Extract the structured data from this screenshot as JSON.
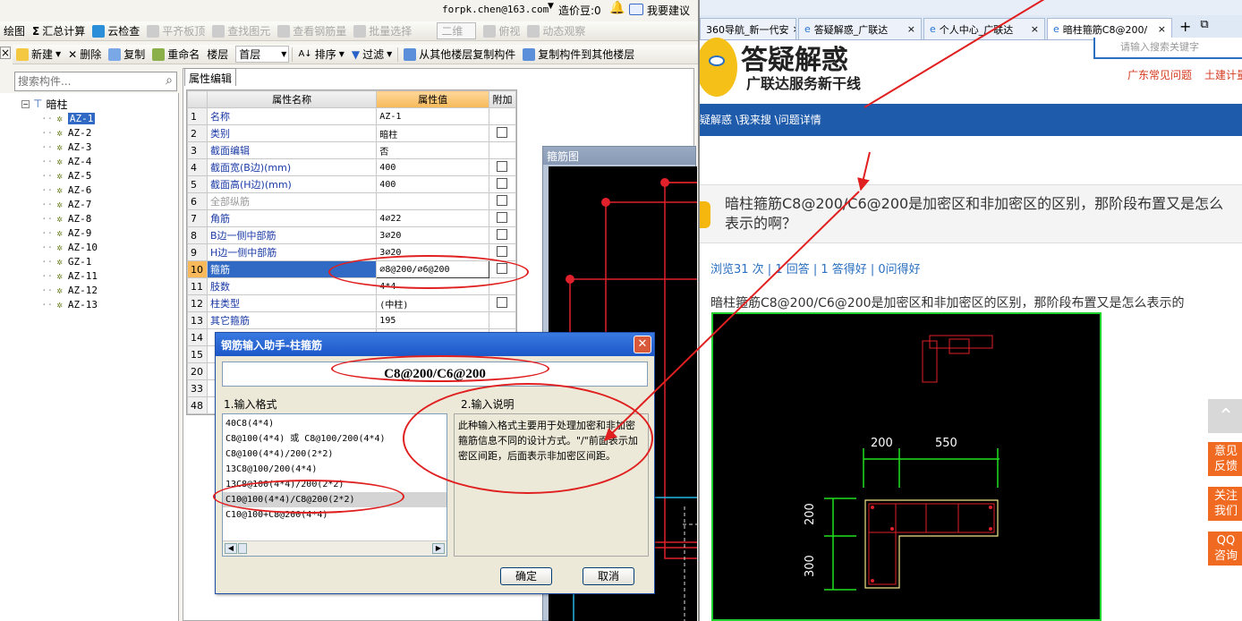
{
  "app": {
    "account": "forpk.chen@163.com",
    "points": "造价豆:0",
    "feedback": "我要建议",
    "toolbar1": [
      "绘图",
      "汇总计算",
      "云检查",
      "平齐板顶",
      "查找图元",
      "查看钢筋量",
      "批量选择",
      "二维",
      "俯视",
      "动态观察"
    ],
    "toolbar2": {
      "new": "新建",
      "delete": "删除",
      "copy": "复制",
      "rename": "重命名",
      "floor_label": "楼层",
      "floor_value": "首层",
      "sort": "排序",
      "filter": "过滤",
      "copy_from": "从其他楼层复制构件",
      "copy_to": "复制构件到其他楼层"
    },
    "search_placeholder": "搜索构件...",
    "tree": {
      "root": "暗柱",
      "items": [
        "AZ-1",
        "AZ-2",
        "AZ-3",
        "AZ-4",
        "AZ-5",
        "AZ-6",
        "AZ-7",
        "AZ-8",
        "AZ-9",
        "AZ-10",
        "GZ-1",
        "AZ-11",
        "AZ-12",
        "AZ-13"
      ]
    },
    "tab": "属性编辑",
    "grid": {
      "headers": [
        "属性名称",
        "属性值",
        "附加"
      ],
      "rows": [
        {
          "n": "1",
          "name": "名称",
          "value": "AZ-1",
          "chk": false
        },
        {
          "n": "2",
          "name": "类别",
          "value": "暗柱",
          "chk": true
        },
        {
          "n": "3",
          "name": "截面编辑",
          "value": "否",
          "chk": false
        },
        {
          "n": "4",
          "name": "截面宽(B边)(mm)",
          "value": "400",
          "chk": true
        },
        {
          "n": "5",
          "name": "截面高(H边)(mm)",
          "value": "400",
          "chk": true
        },
        {
          "n": "6",
          "name": "全部纵筋",
          "value": "",
          "chk": true
        },
        {
          "n": "7",
          "name": "角筋",
          "value": "4⌀22",
          "chk": true
        },
        {
          "n": "8",
          "name": "B边一侧中部筋",
          "value": "3⌀20",
          "chk": true
        },
        {
          "n": "9",
          "name": "H边一侧中部筋",
          "value": "3⌀20",
          "chk": true
        },
        {
          "n": "10",
          "name": "箍筋",
          "value": "⌀8@200/⌀6@200",
          "chk": true
        },
        {
          "n": "11",
          "name": "肢数",
          "value": "4*4",
          "chk": false
        },
        {
          "n": "12",
          "name": "柱类型",
          "value": "(中柱)",
          "chk": true
        },
        {
          "n": "13",
          "name": "其它箍筋",
          "value": "195",
          "chk": false
        },
        {
          "n": "14",
          "name": "",
          "value": "",
          "chk": false
        },
        {
          "n": "15",
          "name": "",
          "value": "",
          "chk": false
        },
        {
          "n": "20",
          "name": "",
          "value": "",
          "chk": false
        },
        {
          "n": "33",
          "name": "",
          "value": "",
          "chk": false
        },
        {
          "n": "48",
          "name": "",
          "value": "",
          "chk": false
        }
      ]
    },
    "drawing_title": "箍筋图",
    "dialog": {
      "title": "钢筋输入助手-柱箍筋",
      "value": "C8@200/C6@200",
      "format_label": "1.输入格式",
      "desc_label": "2.输入说明",
      "formats": [
        "40C8(4*4)",
        "C8@100(4*4) 或 C8@100/200(4*4)",
        "C8@100(4*4)/200(2*2)",
        "13C8@100/200(4*4)",
        "13C8@100(4*4)/200(2*2)",
        "C10@100(4*4)/C8@200(2*2)",
        "C10@100+C8@200(4*4)"
      ],
      "description": "此种输入格式主要用于处理加密和非加密箍筋信息不同的设计方式。\"/\"前面表示加密区间距，后面表示非加密区间距。",
      "ok": "确定",
      "cancel": "取消"
    }
  },
  "browser": {
    "tabs": [
      "360导航_新一代安",
      "答疑解惑_广联达",
      "个人中心_广联达",
      "暗柱箍筋C8@200/"
    ],
    "search_placeholder": "请输入搜索关键字",
    "logo_title": "答疑解惑",
    "logo_sub": "广联达服务新干线",
    "links": [
      "广东常见问题",
      "土建计量"
    ],
    "breadcrumb": "疑解惑 \\我来搜 \\问题详情",
    "question": "暗柱箍筋C8@200/C6@200是加密区和非加密区的区别，那阶段布置又是怎么表示的啊？",
    "stats": "浏览31 次 | 1 回答 | 1 答得好 | 0问得好",
    "body": "暗柱箍筋C8@200/C6@200是加密区和非加密区的区别，那阶段布置又是怎么表示的",
    "dims": {
      "a": "200",
      "b": "550",
      "c": "200",
      "d": "300"
    },
    "side_buttons": [
      "意见反馈",
      "关注我们",
      "QQ咨询"
    ]
  }
}
